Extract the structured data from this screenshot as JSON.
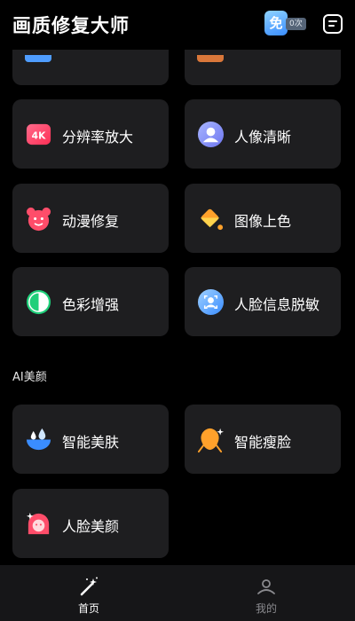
{
  "header": {
    "title": "画质修复大师",
    "free_icon_text": "免",
    "free_count": "0次",
    "menu_icon": "menu-icon"
  },
  "features_top": [
    {
      "label": "分辨率放大",
      "icon": "4k-icon",
      "icon_text": "4K"
    },
    {
      "label": "人像清晰",
      "icon": "portrait-icon"
    },
    {
      "label": "动漫修复",
      "icon": "bear-icon"
    },
    {
      "label": "图像上色",
      "icon": "paint-bucket-icon"
    },
    {
      "label": "色彩增强",
      "icon": "contrast-icon"
    },
    {
      "label": "人脸信息脱敏",
      "icon": "face-scan-icon"
    }
  ],
  "section": {
    "title": "AI美颜"
  },
  "features_beauty": [
    {
      "label": "智能美肤",
      "icon": "skin-drop-icon"
    },
    {
      "label": "智能瘦脸",
      "icon": "slim-face-icon"
    },
    {
      "label": "人脸美颜",
      "icon": "beauty-face-icon"
    }
  ],
  "tabbar": {
    "tabs": [
      {
        "label": "首页",
        "icon": "magic-wand-icon",
        "active": true
      },
      {
        "label": "我的",
        "icon": "profile-icon",
        "active": false
      }
    ]
  },
  "colors": {
    "background": "#000000",
    "card": "#1e1e20",
    "tabbar": "#161618",
    "accent_blue": "#3a8dff",
    "accent_pink": "#ff4d6a",
    "accent_orange": "#ffa12b",
    "accent_green": "#1fcf7a"
  }
}
